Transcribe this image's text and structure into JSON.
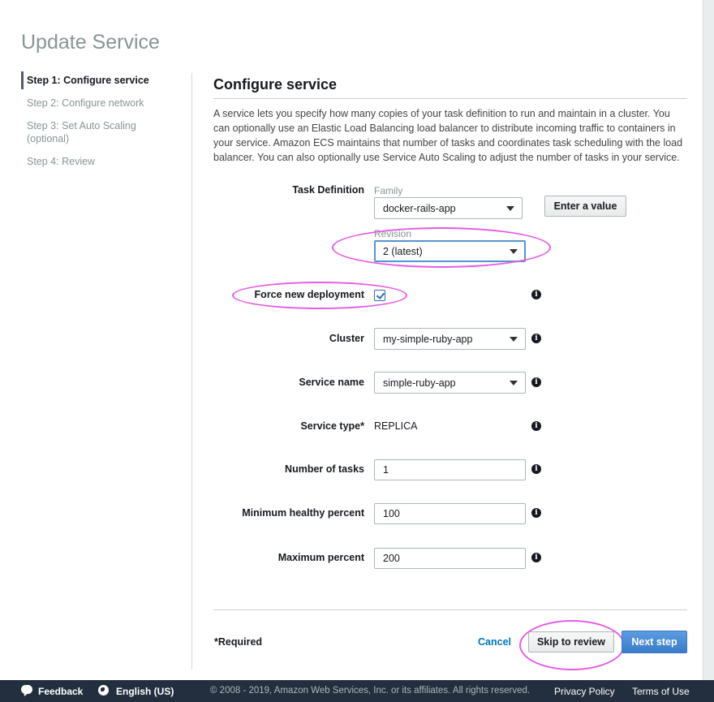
{
  "page": {
    "title": "Update Service"
  },
  "steps": [
    {
      "label": "Step 1: Configure service",
      "active": true
    },
    {
      "label": "Step 2: Configure network",
      "active": false
    },
    {
      "label": "Step 3: Set Auto Scaling (optional)",
      "active": false
    },
    {
      "label": "Step 4: Review",
      "active": false
    }
  ],
  "section": {
    "title": "Configure service",
    "description": "A service lets you specify how many copies of your task definition to run and maintain in a cluster. You can optionally use an Elastic Load Balancing load balancer to distribute incoming traffic to containers in your service. Amazon ECS maintains that number of tasks and coordinates task scheduling with the load balancer. You can also optionally use Service Auto Scaling to adjust the number of tasks in your service."
  },
  "form": {
    "task_definition": {
      "label": "Task Definition",
      "family_label": "Family",
      "family_value": "docker-rails-app",
      "enter_value_button": "Enter a value",
      "revision_label": "Revision",
      "revision_value": "2 (latest)"
    },
    "force_new_deployment": {
      "label": "Force new deployment",
      "checked": true
    },
    "cluster": {
      "label": "Cluster",
      "value": "my-simple-ruby-app"
    },
    "service_name": {
      "label": "Service name",
      "value": "simple-ruby-app"
    },
    "service_type": {
      "label": "Service type*",
      "value": "REPLICA"
    },
    "number_of_tasks": {
      "label": "Number of tasks",
      "value": "1"
    },
    "min_healthy_percent": {
      "label": "Minimum healthy percent",
      "value": "100"
    },
    "max_percent": {
      "label": "Maximum percent",
      "value": "200"
    }
  },
  "footer": {
    "required_note": "*Required",
    "cancel": "Cancel",
    "skip_to_review": "Skip to review",
    "next_step": "Next step"
  },
  "bottom_bar": {
    "feedback": "Feedback",
    "language": "English (US)",
    "copyright": "© 2008 - 2019, Amazon Web Services, Inc. or its affiliates. All rights reserved.",
    "privacy": "Privacy Policy",
    "terms": "Terms of Use"
  },
  "colors": {
    "accent_blue": "#3a7cc8",
    "link": "#0073bb",
    "highlight": "#e65be6",
    "bottom_bar": "#232f3e"
  },
  "icons": [
    "info-icon",
    "chevron-down-icon",
    "checkmark-icon",
    "feedback-icon",
    "globe-icon"
  ]
}
